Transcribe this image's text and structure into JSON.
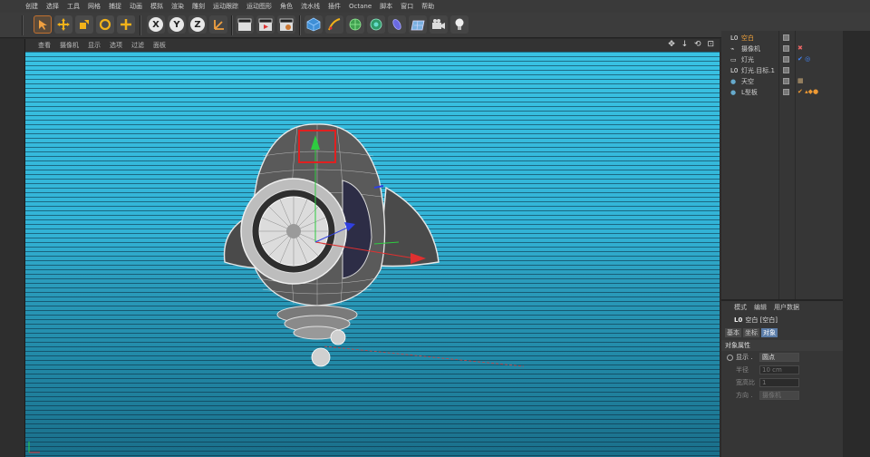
{
  "menu": [
    "创建",
    "选择",
    "工具",
    "网格",
    "捕捉",
    "动画",
    "模拟",
    "渲染",
    "雕刻",
    "运动跟踪",
    "运动图形",
    "角色",
    "流水线",
    "插件",
    "Octane",
    "脚本",
    "窗口",
    "帮助"
  ],
  "toolbar": {
    "axis_x": "X",
    "axis_y": "Y",
    "axis_z": "Z"
  },
  "viewport_menu": [
    "查看",
    "摄像机",
    "显示",
    "选项",
    "过滤",
    "面板"
  ],
  "viewport_icons": "✥ ↓ ⟲ ⊡",
  "objects": [
    {
      "name": "空白",
      "icon": "L0",
      "selected": true
    },
    {
      "name": "摄像机",
      "icon": "⌁",
      "selected": false
    },
    {
      "name": "灯光",
      "icon": "▭",
      "selected": false
    },
    {
      "name": "灯光.目标.1",
      "icon": "L0",
      "selected": false
    },
    {
      "name": "天空",
      "icon": "●",
      "selected": false
    },
    {
      "name": "L型板",
      "icon": "●",
      "selected": false
    }
  ],
  "attributes": {
    "tabs": [
      "模式",
      "编辑",
      "用户数据"
    ],
    "object_title": "空白 [空白]",
    "subtabs": [
      "基本",
      "坐标",
      "对象"
    ],
    "active_subtab": "对象",
    "section": "对象属性",
    "display_label": "显示 .",
    "display_value": "圆点",
    "radius_label": "半径",
    "radius_value": "10 cm",
    "aspect_label": "宽高比",
    "aspect_value": "1",
    "orientation_label": "方向 .",
    "orientation_value": "摄像机"
  },
  "colors": {
    "viewport_sky": "#39c2e3",
    "selection_box": "#e02020",
    "selected_object": "#f2a33a"
  }
}
